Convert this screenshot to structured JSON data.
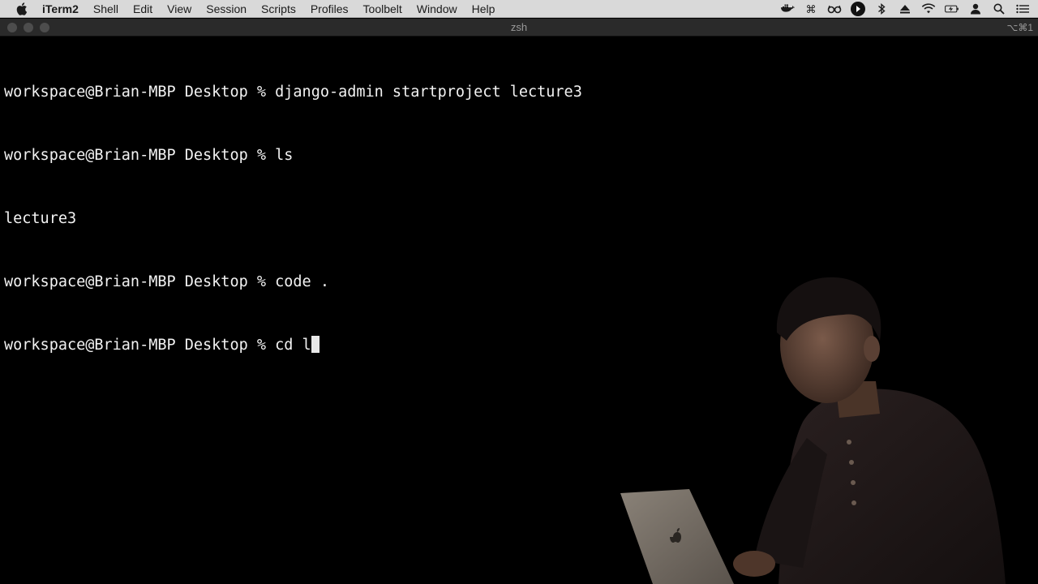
{
  "menubar": {
    "app_name": "iTerm2",
    "items": [
      "Shell",
      "Edit",
      "View",
      "Session",
      "Scripts",
      "Profiles",
      "Toolbelt",
      "Window",
      "Help"
    ],
    "status_icons": [
      "docker-icon",
      "command-icon",
      "glasses-icon",
      "play-circle-icon",
      "bluetooth-icon",
      "eject-icon",
      "wifi-icon",
      "battery-charging-icon",
      "user-icon",
      "search-icon",
      "menu-list-icon"
    ]
  },
  "window": {
    "title": "zsh",
    "shortcut": "⌥⌘1"
  },
  "terminal": {
    "lines": [
      "workspace@Brian-MBP Desktop % django-admin startproject lecture3",
      "workspace@Brian-MBP Desktop % ls",
      "lecture3",
      "workspace@Brian-MBP Desktop % code .",
      "workspace@Brian-MBP Desktop % cd l"
    ]
  },
  "colors": {
    "menubar_bg": "#d9d9d9",
    "terminal_bg": "#000000",
    "terminal_fg": "#f2f2f2"
  }
}
